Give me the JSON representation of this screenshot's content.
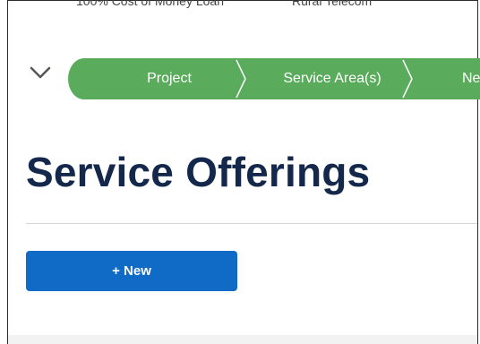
{
  "header": {
    "left_text": "100% Cost of Money Loan",
    "right_text": "Rural Telecom"
  },
  "stepper": {
    "steps": [
      {
        "label": "Project"
      },
      {
        "label": "Service Area(s)"
      },
      {
        "label": "Ne"
      }
    ],
    "color": "#5aab5c"
  },
  "page": {
    "title": "Service Offerings"
  },
  "actions": {
    "new_label": "+ New"
  }
}
